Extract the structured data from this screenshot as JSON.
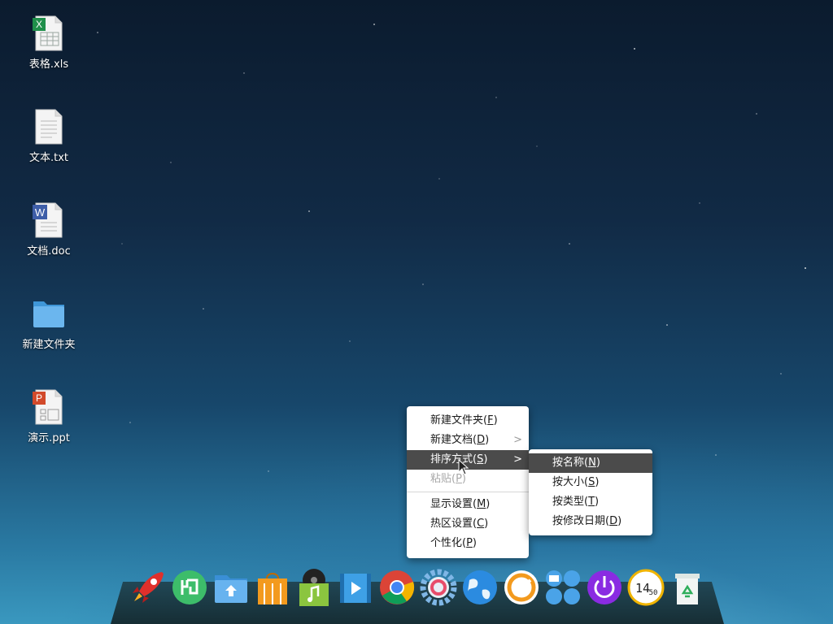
{
  "desktop": {
    "icons": [
      {
        "label": "表格.xls",
        "icon": "spreadsheet-file-icon"
      },
      {
        "label": "文本.txt",
        "icon": "text-file-icon"
      },
      {
        "label": "文档.doc",
        "icon": "word-document-icon"
      },
      {
        "label": "新建文件夹",
        "icon": "folder-icon"
      },
      {
        "label": "演示.ppt",
        "icon": "presentation-file-icon"
      }
    ]
  },
  "context_menu": {
    "items": [
      {
        "text": "新建文件夹(",
        "key": "F",
        "end": ")"
      },
      {
        "text": "新建文档(",
        "key": "D",
        "end": ")",
        "submenu": true
      },
      {
        "text": "排序方式(",
        "key": "S",
        "end": ")",
        "submenu": true,
        "active": true
      },
      {
        "text": "粘贴(",
        "key": "P",
        "end": ")",
        "disabled": true
      },
      {
        "text": "显示设置(",
        "key": "M",
        "end": ")"
      },
      {
        "text": "热区设置(",
        "key": "C",
        "end": ")"
      },
      {
        "text": "个性化(",
        "key": "P",
        "end": ")"
      }
    ],
    "arrow": ">"
  },
  "sort_submenu": {
    "items": [
      {
        "text": "按名称(",
        "key": "N",
        "end": ")",
        "active": true
      },
      {
        "text": "按大小(",
        "key": "S",
        "end": ")"
      },
      {
        "text": "按类型(",
        "key": "T",
        "end": ")"
      },
      {
        "text": "按修改日期(",
        "key": "D",
        "end": ")"
      }
    ]
  },
  "dock": {
    "apps": [
      "launcher-rocket-icon",
      "app-store-icon",
      "file-manager-icon",
      "store-bag-icon",
      "music-player-icon",
      "video-player-icon",
      "chrome-browser-icon",
      "settings-gear-icon",
      "internet-globe-icon",
      "screenshot-icon",
      "input-method-icon",
      "power-icon",
      "clock-icon",
      "trash-icon"
    ],
    "clock_text_hour": "14",
    "clock_text_min": "50"
  }
}
